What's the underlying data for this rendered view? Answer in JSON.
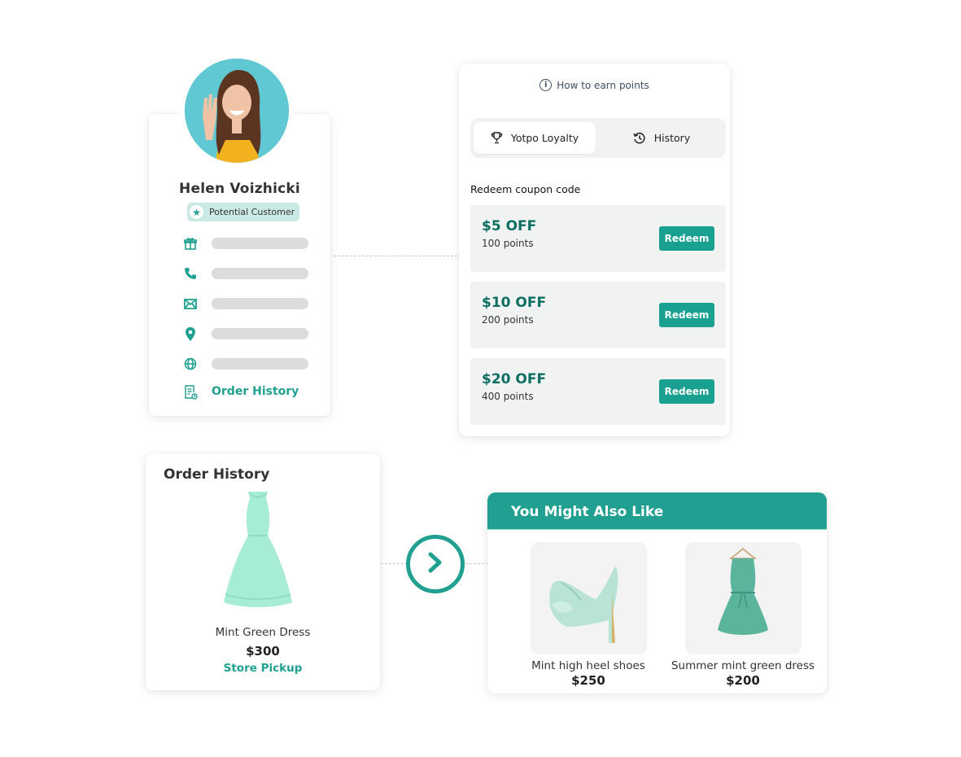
{
  "profile": {
    "name": "Helen Voizhicki",
    "badge": "Potential Customer",
    "info_rows": [
      {
        "icon": "gift-icon"
      },
      {
        "icon": "phone-icon"
      },
      {
        "icon": "mail-icon"
      },
      {
        "icon": "location-pin-icon"
      },
      {
        "icon": "globe-icon"
      }
    ],
    "order_history_link": "Order History"
  },
  "loyalty": {
    "earn_link": "How to earn points",
    "tabs": [
      {
        "label": "Yotpo Loyalty",
        "icon": "trophy-icon",
        "active": true
      },
      {
        "label": "History",
        "icon": "history-icon",
        "active": false
      }
    ],
    "section_title": "Redeem coupon code",
    "coupons": [
      {
        "amount": "$5 OFF",
        "points": "100 points",
        "button": "Redeem"
      },
      {
        "amount": "$10 OFF",
        "points": "200 points",
        "button": "Redeem"
      },
      {
        "amount": "$20 OFF",
        "points": "400 points",
        "button": "Redeem"
      }
    ]
  },
  "order_history": {
    "title": "Order History",
    "item": {
      "name": "Mint Green Dress",
      "price": "$300",
      "fulfillment": "Store Pickup"
    }
  },
  "recommendations": {
    "title": "You Might Also Like",
    "items": [
      {
        "name": "Mint high heel shoes",
        "price": "$250"
      },
      {
        "name": "Summer mint green dress",
        "price": "$200"
      }
    ]
  },
  "colors": {
    "accent": "#20a090",
    "accent_dark": "#0e6e61",
    "coupon_bg": "#f0f3f1",
    "header_bg": "#21a091"
  }
}
